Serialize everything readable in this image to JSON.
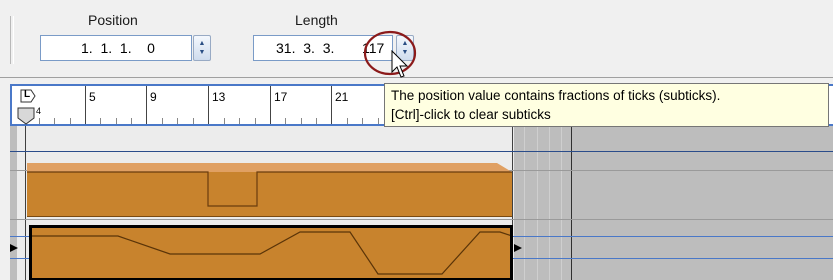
{
  "toolbar": {
    "position": {
      "label": "Position",
      "value": "1.  1.  1.    0"
    },
    "length": {
      "label": "Length",
      "value": "31.  3.  3.",
      "subticks": "117"
    }
  },
  "ruler": {
    "ticks": [
      "5",
      "9",
      "13",
      "17",
      "21"
    ],
    "locator_left": "L",
    "locator_sub": "4"
  },
  "tooltip": {
    "line1": "The position value contains fractions of ticks (subticks).",
    "line2": "[Ctrl]-click to clear subticks"
  },
  "colors": {
    "event_fill": "#c8832d",
    "event_border": "#7a4a12",
    "annotation_circle": "#8b1a1a",
    "tooltip_bg": "#ffffe1",
    "ruler_border": "#4a78c8"
  },
  "icons": {
    "spinner": "up-down-arrows",
    "cursor": "mouse-pointer",
    "locator": "pentagon-flag"
  }
}
